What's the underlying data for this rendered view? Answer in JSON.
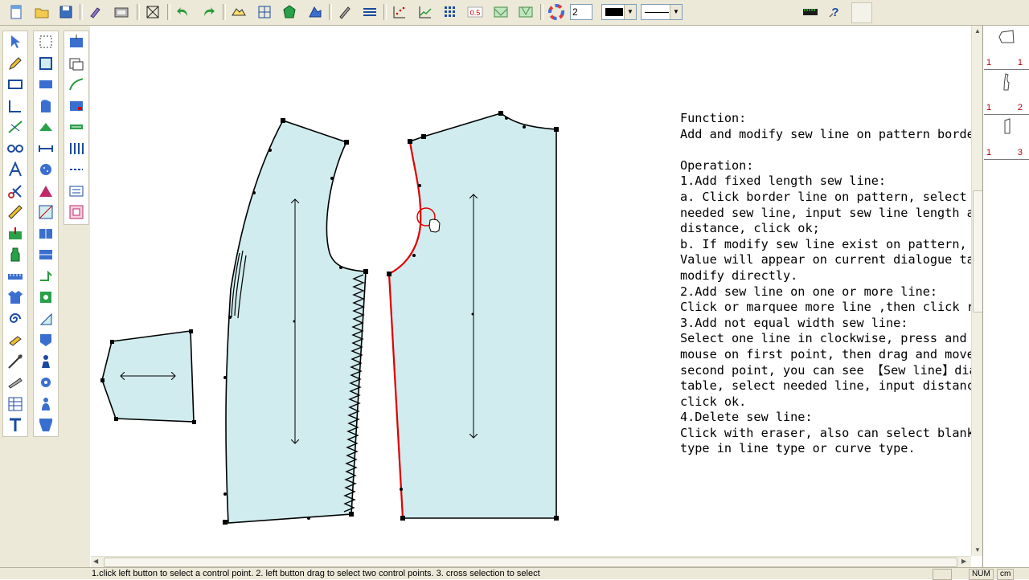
{
  "toolbar": {
    "line_width": "2",
    "color_swatch": "#000000",
    "line_style": "solid",
    "icons": [
      "new-icon",
      "open-icon",
      "save-icon",
      "print-icon",
      "scan-icon",
      "grade-icon",
      "undo-icon",
      "redo-icon",
      "pattern-view-icon",
      "sketch-icon",
      "fill-icon",
      "mark-icon",
      "edit-icon",
      "align-icon",
      "grid-icon",
      "chart-icon",
      "table-icon",
      "step-icon",
      "curve-icon",
      "dart-icon",
      "color-wheel-icon",
      "ruler-icon",
      "help-icon"
    ],
    "step_label": "0.5"
  },
  "help": {
    "lines": [
      "Function:",
      "Add and modify sew line on pattern border.",
      "",
      "Operation:",
      "1.Add fixed length sew line:",
      "a. Click border line on pattern, select",
      "needed sew line, input sew line length and",
      "distance, click ok;",
      "b. If modify sew line exist on pattern,",
      "Value will appear on current dialogue table,",
      "modify directly.",
      "2.Add sew line on one or more line:",
      "Click or marquee more line ,then click right.",
      "3.Add not equal width sew line:",
      "Select one line in clockwise, press and hold",
      "mouse on first point, then drag and move to",
      "second point, you can see 【Sew line】dialogue",
      "table, select needed line, input distance,",
      "click ok.",
      "4.Delete sew line:",
      "Click with eraser, also can select blank line",
      "type in line type or curve type."
    ]
  },
  "pieces_panel": [
    {
      "left": "1",
      "right": "1"
    },
    {
      "left": "1",
      "right": "2"
    },
    {
      "left": "1",
      "right": "3"
    }
  ],
  "status": {
    "hint": "1.click left button to select a control point.  2. left button drag to select two control points. 3. cross selection to select",
    "num": "NUM",
    "unit": "cm"
  },
  "colors": {
    "piece_fill": "#d0ecee",
    "sew_line": "#e00000",
    "chrome": "#ece9d8"
  }
}
